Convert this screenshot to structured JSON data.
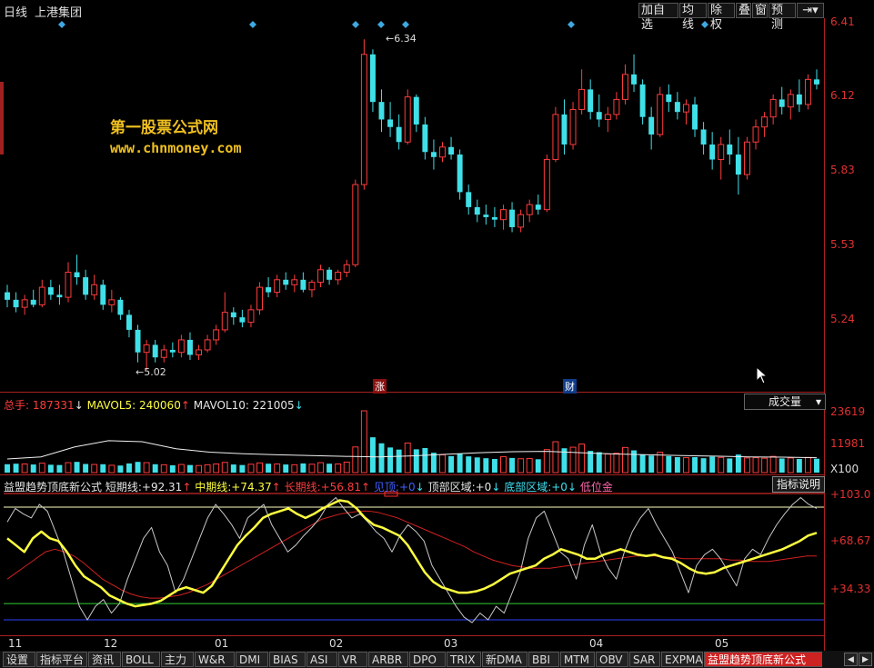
{
  "toolbar": {
    "period": "日线",
    "stock_name": "上港集团",
    "buttons": [
      "加自选",
      "均线",
      "除权",
      "叠",
      "窗",
      "预测"
    ],
    "menu_icon": "arrow-menu-icon"
  },
  "price_axis": {
    "labels": [
      "6.41",
      "6.12",
      "5.83",
      "5.53",
      "5.24"
    ]
  },
  "volume_axis": {
    "labels": [
      "23619",
      "11981",
      "X100"
    ]
  },
  "indicator_axis": {
    "labels": [
      "+103.0",
      "+68.67",
      "+34.33"
    ]
  },
  "watermark": {
    "line1": "第一股票公式网",
    "line2": "www.chnmoney.com"
  },
  "annotations": {
    "high": "6.34",
    "low": "5.02",
    "tag_zhang": "涨",
    "tag_cai": "财"
  },
  "volume_legend": {
    "total_label": "总手:",
    "total_value": "187331",
    "mavol5_label": "MAVOL5:",
    "mavol5_value": "240060",
    "mavol10_label": "MAVOL10:",
    "mavol10_value": "221005",
    "selector": "成交量"
  },
  "indicator_legend": {
    "name": "益盟趋势顶底新公式",
    "short_label": "短期线:",
    "short_value": "+92.31",
    "mid_label": "中期线:",
    "mid_value": "+74.37",
    "long_label": "长期线:",
    "long_value": "+56.81",
    "top_label": "见顶:",
    "top_value": "+0",
    "topzone_label": "顶部区域:",
    "topzone_value": "+0",
    "bottomzone_label": "底部区域:",
    "bottomzone_value": "+0",
    "low_label": "低位金",
    "help_button": "指标说明"
  },
  "x_axis": {
    "labels": [
      "11",
      "12",
      "01",
      "02",
      "03",
      "04",
      "05"
    ]
  },
  "tabs": [
    "设置",
    "指标平台",
    "资讯",
    "BOLL",
    "主力",
    "W&R",
    "DMI",
    "BIAS",
    "ASI",
    "VR",
    "ARBR",
    "DPO",
    "TRIX",
    "新DMA",
    "BBI",
    "MTM",
    "OBV",
    "SAR",
    "EXPMA",
    "益盟趋势顶底新公式"
  ],
  "colors": {
    "up": "#ff3c3c",
    "down": "#40e0e8",
    "background": "#000000",
    "frame": "#aa2020"
  },
  "chart_data": {
    "type": "candlestick",
    "price_ylim": [
      5.02,
      6.41
    ],
    "ohlc": [
      [
        5.33,
        5.36,
        5.27,
        5.3
      ],
      [
        5.3,
        5.33,
        5.25,
        5.27
      ],
      [
        5.27,
        5.32,
        5.24,
        5.3
      ],
      [
        5.3,
        5.34,
        5.27,
        5.28
      ],
      [
        5.28,
        5.38,
        5.27,
        5.35
      ],
      [
        5.35,
        5.38,
        5.3,
        5.32
      ],
      [
        5.32,
        5.36,
        5.28,
        5.31
      ],
      [
        5.31,
        5.45,
        5.29,
        5.41
      ],
      [
        5.41,
        5.48,
        5.36,
        5.39
      ],
      [
        5.39,
        5.42,
        5.3,
        5.32
      ],
      [
        5.32,
        5.4,
        5.3,
        5.36
      ],
      [
        5.36,
        5.38,
        5.26,
        5.28
      ],
      [
        5.28,
        5.34,
        5.25,
        5.3
      ],
      [
        5.3,
        5.31,
        5.22,
        5.24
      ],
      [
        5.24,
        5.26,
        5.15,
        5.18
      ],
      [
        5.18,
        5.2,
        5.05,
        5.09
      ],
      [
        5.09,
        5.14,
        5.02,
        5.12
      ],
      [
        5.12,
        5.14,
        5.05,
        5.07
      ],
      [
        5.07,
        5.12,
        5.05,
        5.1
      ],
      [
        5.1,
        5.13,
        5.07,
        5.09
      ],
      [
        5.09,
        5.16,
        5.07,
        5.14
      ],
      [
        5.14,
        5.17,
        5.06,
        5.08
      ],
      [
        5.08,
        5.12,
        5.06,
        5.1
      ],
      [
        5.1,
        5.16,
        5.09,
        5.14
      ],
      [
        5.14,
        5.2,
        5.12,
        5.18
      ],
      [
        5.18,
        5.33,
        5.17,
        5.25
      ],
      [
        5.25,
        5.27,
        5.2,
        5.23
      ],
      [
        5.23,
        5.26,
        5.19,
        5.21
      ],
      [
        5.21,
        5.28,
        5.19,
        5.26
      ],
      [
        5.26,
        5.37,
        5.24,
        5.35
      ],
      [
        5.35,
        5.39,
        5.31,
        5.33
      ],
      [
        5.33,
        5.4,
        5.31,
        5.38
      ],
      [
        5.38,
        5.41,
        5.34,
        5.36
      ],
      [
        5.36,
        5.4,
        5.33,
        5.38
      ],
      [
        5.38,
        5.41,
        5.33,
        5.34
      ],
      [
        5.34,
        5.38,
        5.31,
        5.37
      ],
      [
        5.37,
        5.44,
        5.35,
        5.42
      ],
      [
        5.42,
        5.43,
        5.36,
        5.38
      ],
      [
        5.38,
        5.42,
        5.36,
        5.41
      ],
      [
        5.41,
        5.46,
        5.39,
        5.44
      ],
      [
        5.44,
        5.78,
        5.43,
        5.76
      ],
      [
        5.76,
        6.34,
        5.74,
        6.28
      ],
      [
        6.28,
        6.3,
        6.05,
        6.09
      ],
      [
        6.09,
        6.14,
        5.97,
        6.02
      ],
      [
        6.02,
        6.09,
        5.95,
        5.99
      ],
      [
        5.99,
        6.04,
        5.9,
        5.93
      ],
      [
        5.93,
        6.14,
        5.92,
        6.11
      ],
      [
        6.11,
        6.12,
        5.97,
        6.0
      ],
      [
        6.0,
        6.03,
        5.86,
        5.89
      ],
      [
        5.89,
        5.94,
        5.82,
        5.87
      ],
      [
        5.87,
        5.93,
        5.85,
        5.91
      ],
      [
        5.91,
        5.95,
        5.86,
        5.88
      ],
      [
        5.88,
        5.9,
        5.7,
        5.73
      ],
      [
        5.73,
        5.76,
        5.64,
        5.67
      ],
      [
        5.67,
        5.7,
        5.61,
        5.64
      ],
      [
        5.64,
        5.68,
        5.6,
        5.63
      ],
      [
        5.63,
        5.67,
        5.59,
        5.62
      ],
      [
        5.62,
        5.68,
        5.58,
        5.66
      ],
      [
        5.66,
        5.69,
        5.57,
        5.59
      ],
      [
        5.59,
        5.66,
        5.57,
        5.64
      ],
      [
        5.64,
        5.7,
        5.61,
        5.68
      ],
      [
        5.68,
        5.72,
        5.64,
        5.66
      ],
      [
        5.66,
        5.88,
        5.65,
        5.86
      ],
      [
        5.86,
        6.07,
        5.85,
        6.04
      ],
      [
        6.04,
        6.1,
        5.88,
        5.92
      ],
      [
        5.92,
        6.09,
        5.9,
        6.06
      ],
      [
        6.06,
        6.22,
        6.04,
        6.14
      ],
      [
        6.14,
        6.18,
        6.02,
        6.05
      ],
      [
        6.05,
        6.12,
        5.99,
        6.02
      ],
      [
        6.02,
        6.07,
        5.97,
        6.04
      ],
      [
        6.04,
        6.13,
        6.02,
        6.1
      ],
      [
        6.1,
        6.24,
        6.08,
        6.2
      ],
      [
        6.2,
        6.28,
        6.13,
        6.16
      ],
      [
        6.16,
        6.18,
        6.0,
        6.03
      ],
      [
        6.03,
        6.07,
        5.9,
        5.96
      ],
      [
        5.96,
        6.15,
        5.95,
        6.12
      ],
      [
        6.12,
        6.16,
        6.05,
        6.09
      ],
      [
        6.09,
        6.13,
        6.02,
        6.05
      ],
      [
        6.05,
        6.1,
        6.0,
        6.08
      ],
      [
        6.08,
        6.11,
        5.95,
        5.98
      ],
      [
        5.98,
        6.01,
        5.88,
        5.92
      ],
      [
        5.92,
        5.97,
        5.82,
        5.86
      ],
      [
        5.86,
        5.95,
        5.78,
        5.92
      ],
      [
        5.92,
        5.98,
        5.84,
        5.88
      ],
      [
        5.88,
        5.95,
        5.72,
        5.8
      ],
      [
        5.8,
        5.95,
        5.78,
        5.93
      ],
      [
        5.93,
        6.02,
        5.9,
        5.99
      ],
      [
        5.99,
        6.05,
        5.95,
        6.03
      ],
      [
        6.03,
        6.12,
        6.0,
        6.1
      ],
      [
        6.1,
        6.15,
        6.04,
        6.07
      ],
      [
        6.07,
        6.14,
        6.02,
        6.12
      ],
      [
        6.12,
        6.18,
        6.05,
        6.08
      ],
      [
        6.08,
        6.2,
        6.06,
        6.18
      ],
      [
        6.18,
        6.22,
        6.14,
        6.16
      ]
    ],
    "volume_ylim": [
      0,
      23619
    ],
    "volume": [
      3200,
      3400,
      3300,
      3100,
      3600,
      3000,
      2900,
      3800,
      4100,
      3300,
      3100,
      3200,
      2800,
      2700,
      3500,
      4100,
      3800,
      3200,
      3000,
      2800,
      3100,
      2900,
      2700,
      3000,
      3300,
      3900,
      3100,
      2900,
      3200,
      3700,
      3400,
      3300,
      3100,
      3000,
      3500,
      3200,
      3800,
      3400,
      3300,
      4000,
      9800,
      23619,
      13500,
      11200,
      9600,
      8800,
      11300,
      8900,
      9400,
      7600,
      6800,
      6300,
      7200,
      6200,
      5800,
      5500,
      5200,
      6100,
      5600,
      5300,
      5400,
      5100,
      8800,
      11800,
      9300,
      9700,
      10900,
      8300,
      7800,
      7100,
      7400,
      9600,
      8500,
      6800,
      6500,
      7800,
      6300,
      5900,
      5700,
      5900,
      5500,
      6100,
      5800,
      5400,
      6900,
      5600,
      5700,
      5500,
      6200,
      5400,
      5600,
      5200,
      5800,
      5300
    ],
    "mavol5": [
      5200,
      6000,
      9800,
      12200,
      11800,
      9100,
      7800,
      7200,
      6800,
      6500,
      6200,
      6000,
      6400,
      7000,
      7600,
      8000,
      8100,
      7600,
      7100,
      6800,
      6500,
      6300,
      6000,
      5900,
      5700
    ],
    "indicator_ylim": [
      0,
      103
    ],
    "indicator_reference_levels": [
      103,
      93,
      22,
      10
    ],
    "short_line": [
      82,
      92,
      88,
      85,
      95,
      90,
      75,
      60,
      40,
      20,
      10,
      20,
      25,
      15,
      22,
      40,
      55,
      70,
      78,
      60,
      50,
      30,
      40,
      55,
      70,
      85,
      95,
      88,
      80,
      70,
      85,
      90,
      95,
      80,
      70,
      60,
      65,
      72,
      78,
      85,
      95,
      100,
      92,
      85,
      88,
      82,
      75,
      70,
      60,
      72,
      80,
      75,
      68,
      50,
      40,
      30,
      20,
      12,
      8,
      15,
      10,
      20,
      15,
      30,
      45,
      70,
      85,
      90,
      75,
      60,
      55,
      40,
      65,
      80,
      60,
      48,
      40,
      60,
      75,
      85,
      92,
      80,
      70,
      60,
      45,
      30,
      50,
      58,
      62,
      55,
      45,
      35,
      55,
      62,
      58,
      70,
      80,
      88,
      95,
      100,
      95,
      92
    ],
    "mid_line": [
      70,
      65,
      60,
      70,
      75,
      70,
      68,
      60,
      50,
      42,
      38,
      34,
      28,
      25,
      22,
      20,
      21,
      22,
      24,
      28,
      32,
      34,
      32,
      30,
      35,
      45,
      55,
      65,
      72,
      78,
      85,
      88,
      90,
      92,
      88,
      85,
      88,
      92,
      95,
      98,
      97,
      92,
      85,
      80,
      78,
      75,
      72,
      65,
      55,
      45,
      38,
      34,
      32,
      30,
      30,
      31,
      33,
      36,
      40,
      44,
      46,
      48,
      50,
      55,
      58,
      62,
      60,
      58,
      55,
      55,
      58,
      60,
      62,
      60,
      58,
      57,
      58,
      56,
      55,
      52,
      48,
      45,
      44,
      45,
      48,
      50,
      52,
      54,
      56,
      58,
      60,
      62,
      65,
      68,
      72,
      74
    ],
    "long_line": [
      40,
      45,
      50,
      55,
      60,
      62,
      60,
      57,
      52,
      46,
      40,
      36,
      32,
      29,
      27,
      26,
      26,
      27,
      28,
      30,
      33,
      36,
      40,
      44,
      48,
      52,
      56,
      60,
      64,
      68,
      72,
      76,
      80,
      84,
      86,
      88,
      89,
      90,
      90,
      89,
      87,
      85,
      82,
      79,
      76,
      73,
      70,
      67,
      64,
      60,
      57,
      54,
      52,
      50,
      49,
      48,
      48,
      48,
      49,
      50,
      51,
      52,
      53,
      54,
      55,
      56,
      57,
      57,
      57,
      56,
      56,
      55,
      55,
      55,
      55,
      55,
      54,
      54,
      53,
      53,
      53,
      54,
      55,
      56,
      57,
      57
    ]
  }
}
